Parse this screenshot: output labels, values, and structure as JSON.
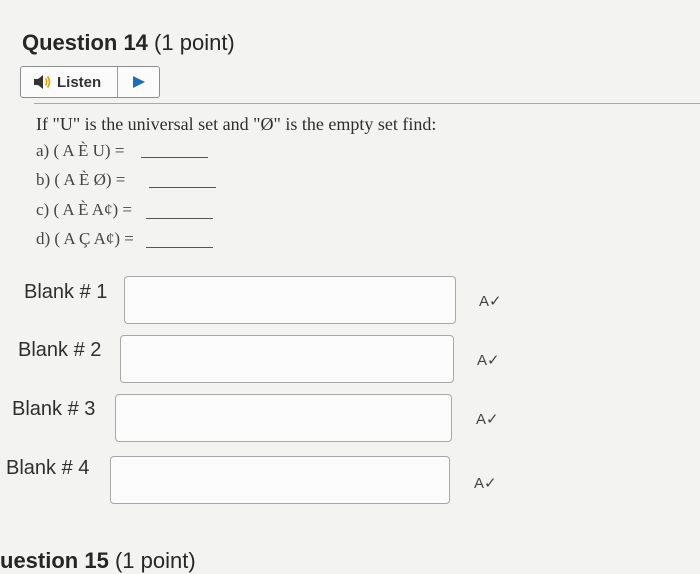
{
  "question": {
    "title": "Question 14",
    "points": "(1 point)"
  },
  "listen": {
    "label": "Listen",
    "speaker_icon": "speaker-icon",
    "play_icon": "play-icon"
  },
  "prompt": "If \"U\" is the universal set and \"Ø\" is the empty set find:",
  "items": [
    {
      "text": "a) ( A È U) ="
    },
    {
      "text": "b) ( A È Ø) ="
    },
    {
      "text": "c) ( A È A¢) ="
    },
    {
      "text": "d) ( A Ç A¢) ="
    }
  ],
  "blanks": [
    {
      "label": "Blank # 1",
      "value": "",
      "spell_icon": "spellcheck-icon",
      "spell_glyph": "A✓"
    },
    {
      "label": "Blank # 2",
      "value": "",
      "spell_icon": "spellcheck-icon",
      "spell_glyph": "A✓"
    },
    {
      "label": "Blank # 3",
      "value": "",
      "spell_icon": "spellcheck-icon",
      "spell_glyph": "A✓"
    },
    {
      "label": "Blank # 4",
      "value": "",
      "spell_icon": "spellcheck-icon",
      "spell_glyph": "A✓"
    }
  ],
  "next_question": {
    "title": "uestion 15",
    "points": "(1 point)"
  }
}
